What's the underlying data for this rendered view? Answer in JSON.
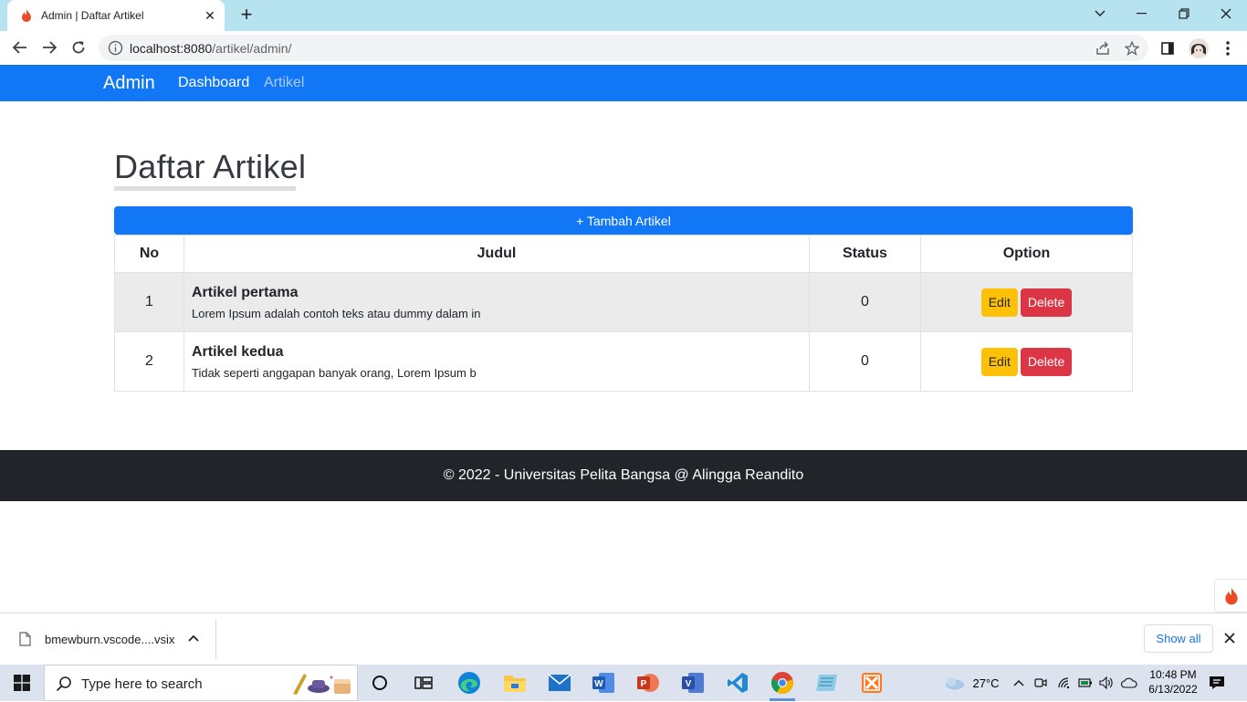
{
  "browser": {
    "tab_title": "Admin | Daftar Artikel",
    "url_host": "localhost:8080",
    "url_path": "/artikel/admin/"
  },
  "navbar": {
    "brand": "Admin",
    "links": [
      "Dashboard",
      "Artikel"
    ]
  },
  "main": {
    "title": "Daftar Artikel",
    "add_button": "+ Tambah Artikel",
    "table": {
      "headers": [
        "No",
        "Judul",
        "Status",
        "Option"
      ],
      "rows": [
        {
          "no": "1",
          "title": "Artikel pertama",
          "excerpt": "Lorem Ipsum adalah contoh teks atau dummy dalam in",
          "status": "0"
        },
        {
          "no": "2",
          "title": "Artikel kedua",
          "excerpt": "Tidak seperti anggapan banyak orang, Lorem Ipsum b",
          "status": "0"
        }
      ],
      "edit_label": "Edit",
      "delete_label": "Delete"
    }
  },
  "footer": {
    "text": "© 2022 - Universitas Pelita Bangsa @ Alingga Reandito"
  },
  "downloads": {
    "file_name": "bmewburn.vscode....vsix",
    "show_all": "Show all"
  },
  "taskbar": {
    "search_placeholder": "Type here to search",
    "temperature": "27°C",
    "time": "10:48 PM",
    "date": "6/13/2022"
  },
  "colors": {
    "navbar": "#1277f7",
    "edit": "#ffc107",
    "delete": "#dc3545",
    "footer": "#212529",
    "tabstrip": "#b7e3f0"
  }
}
